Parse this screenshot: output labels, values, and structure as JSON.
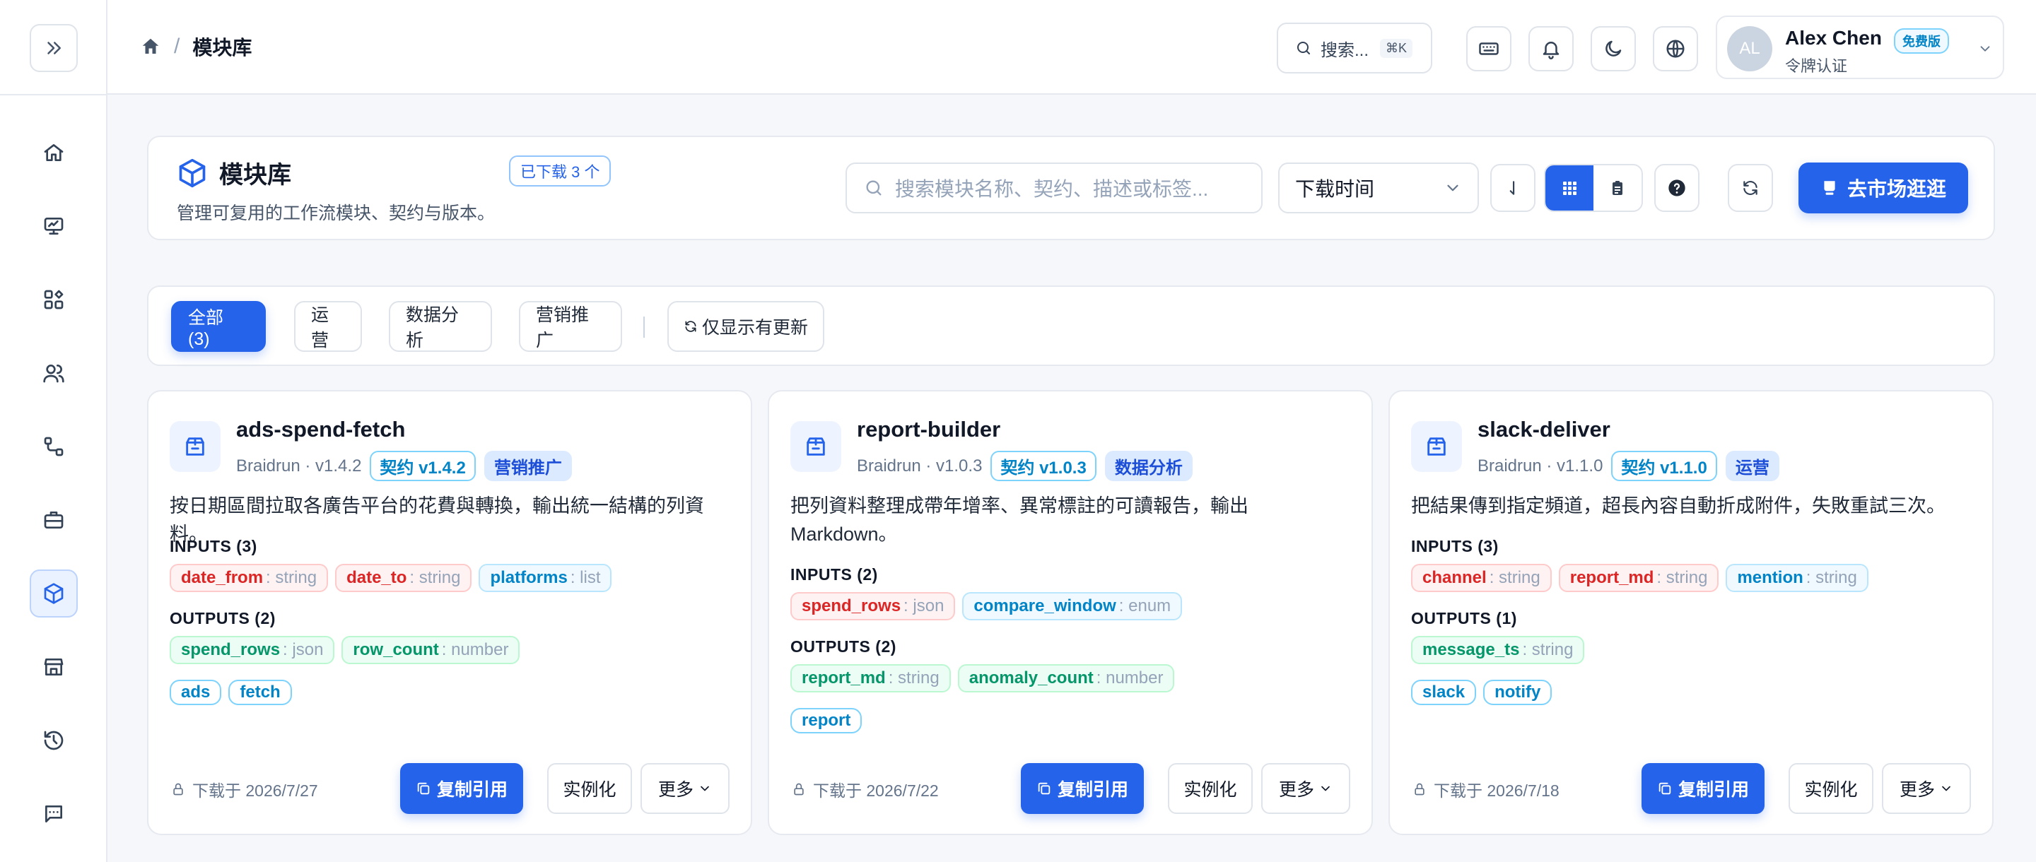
{
  "app": {
    "breadcrumb": {
      "home_icon": "home-icon",
      "separator": "/",
      "current": "模块库"
    }
  },
  "topbar": {
    "search_label": "搜索...",
    "search_shortcut": "⌘K",
    "icons": [
      "keyboard-icon",
      "bell-icon",
      "moon-icon",
      "globe-icon"
    ],
    "user": {
      "initials": "AL",
      "name": "Alex Chen",
      "plan": "免费版",
      "auth": "令牌认证"
    }
  },
  "sidebar": {
    "items": [
      {
        "name": "home",
        "icon": "home-icon",
        "active": false
      },
      {
        "name": "dashboard",
        "icon": "monitor-chart-icon",
        "active": false
      },
      {
        "name": "apps",
        "icon": "apps-grid-icon",
        "active": false
      },
      {
        "name": "users",
        "icon": "users-icon",
        "active": false
      },
      {
        "name": "workflows",
        "icon": "workflow-icon",
        "active": false
      },
      {
        "name": "toolbox",
        "icon": "briefcase-icon",
        "active": false
      },
      {
        "name": "modules",
        "icon": "cube-icon",
        "active": true
      },
      {
        "name": "market",
        "icon": "store-icon",
        "active": false
      },
      {
        "name": "history",
        "icon": "history-icon",
        "active": false
      },
      {
        "name": "messages",
        "icon": "message-icon",
        "active": false
      }
    ]
  },
  "header": {
    "title": "模块库",
    "downloaded_badge": "已下载 3 个",
    "subtitle": "管理可复用的工作流模块、契约与版本。",
    "search_placeholder": "搜索模块名称、契约、描述或标签...",
    "sort_value": "下载时间",
    "market_button": "去市场逛逛"
  },
  "filters": {
    "all": "全部 (3)",
    "ops": "运营",
    "analytics": "数据分析",
    "marketing": "营销推广",
    "updates_only": "仅显示有更新"
  },
  "colors": {
    "accent": "#2563eb",
    "param_input": "#dc2626",
    "param_alt": "#0284c7",
    "param_output": "#059669"
  },
  "modules": [
    {
      "name": "ads-spend-fetch",
      "meta": "Braidrun · v1.4.2",
      "contract": "契约 v1.4.2",
      "category": "营销推广",
      "description": "按日期區間拉取各廣告平台的花費與轉換，輸出統一結構的列資料。",
      "inputs_label": "INPUTS (3)",
      "inputs": [
        {
          "name": "date_from",
          "type": ": string",
          "color": "red"
        },
        {
          "name": "date_to",
          "type": ": string",
          "color": "red"
        },
        {
          "name": "platforms",
          "type": ": list",
          "color": "blue"
        }
      ],
      "outputs_label": "OUTPUTS (2)",
      "outputs": [
        {
          "name": "spend_rows",
          "type": ": json"
        },
        {
          "name": "row_count",
          "type": ": number"
        }
      ],
      "tags": [
        "ads",
        "fetch"
      ],
      "downloaded": "下载于 2026/7/27",
      "copy_label": "复制引用",
      "instantiate_label": "实例化",
      "more_label": "更多"
    },
    {
      "name": "report-builder",
      "meta": "Braidrun · v1.0.3",
      "contract": "契约 v1.0.3",
      "category": "数据分析",
      "description": "把列資料整理成帶年增率、異常標註的可讀報告，輸出 Markdown。",
      "inputs_label": "INPUTS (2)",
      "inputs": [
        {
          "name": "spend_rows",
          "type": ": json",
          "color": "red"
        },
        {
          "name": "compare_window",
          "type": ": enum",
          "color": "blue"
        }
      ],
      "outputs_label": "OUTPUTS (2)",
      "outputs": [
        {
          "name": "report_md",
          "type": ": string"
        },
        {
          "name": "anomaly_count",
          "type": ": number"
        }
      ],
      "tags": [
        "report"
      ],
      "downloaded": "下载于 2026/7/22",
      "copy_label": "复制引用",
      "instantiate_label": "实例化",
      "more_label": "更多"
    },
    {
      "name": "slack-deliver",
      "meta": "Braidrun · v1.1.0",
      "contract": "契约 v1.1.0",
      "category": "运营",
      "description": "把結果傳到指定頻道，超長內容自動折成附件，失敗重試三次。",
      "inputs_label": "INPUTS (3)",
      "inputs": [
        {
          "name": "channel",
          "type": ": string",
          "color": "red"
        },
        {
          "name": "report_md",
          "type": ": string",
          "color": "red"
        },
        {
          "name": "mention",
          "type": ": string",
          "color": "blue"
        }
      ],
      "outputs_label": "OUTPUTS (1)",
      "outputs": [
        {
          "name": "message_ts",
          "type": ": string"
        }
      ],
      "tags": [
        "slack",
        "notify"
      ],
      "downloaded": "下载于 2026/7/18",
      "copy_label": "复制引用",
      "instantiate_label": "实例化",
      "more_label": "更多"
    }
  ]
}
